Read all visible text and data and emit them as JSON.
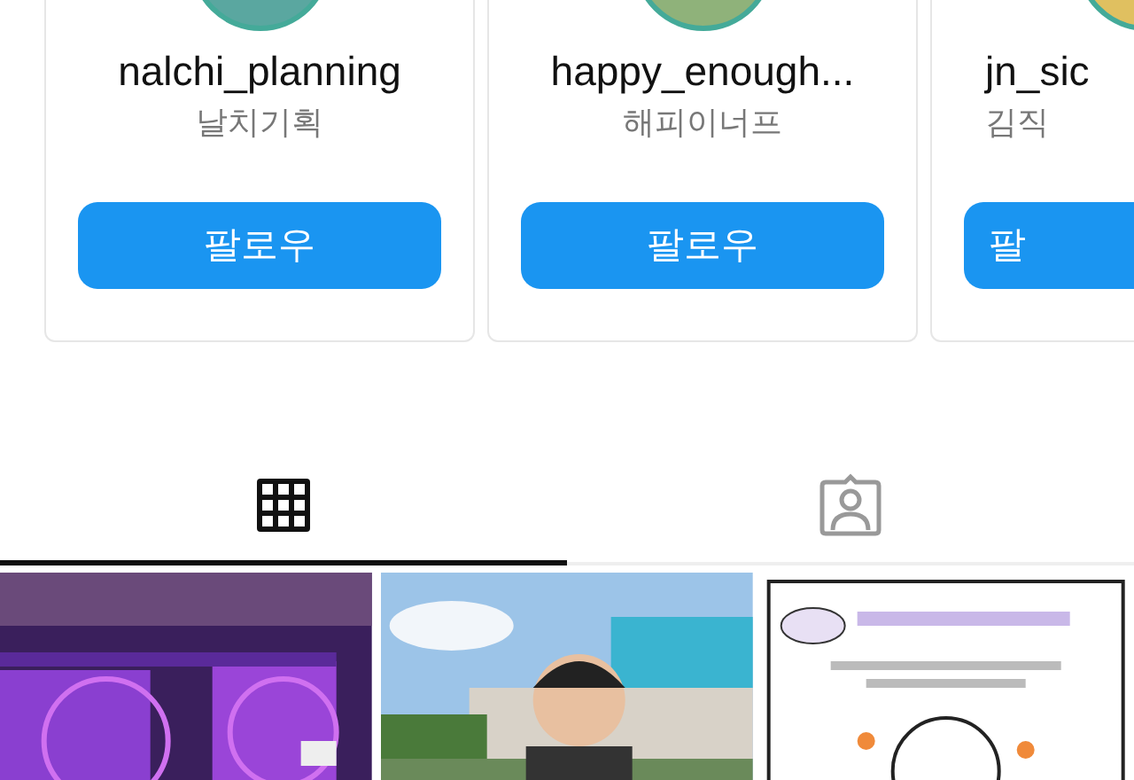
{
  "suggestions": [
    {
      "username": "nalchi_planning",
      "name": "날치기획",
      "button": "팔로우"
    },
    {
      "username": "happy_enough...",
      "name": "해피이너프",
      "button": "팔로우"
    },
    {
      "username": "jn_sic",
      "name": "김직",
      "button": "팔"
    }
  ],
  "tabs": [
    {
      "kind": "grid",
      "selected": true
    },
    {
      "kind": "tagged",
      "selected": false
    }
  ]
}
